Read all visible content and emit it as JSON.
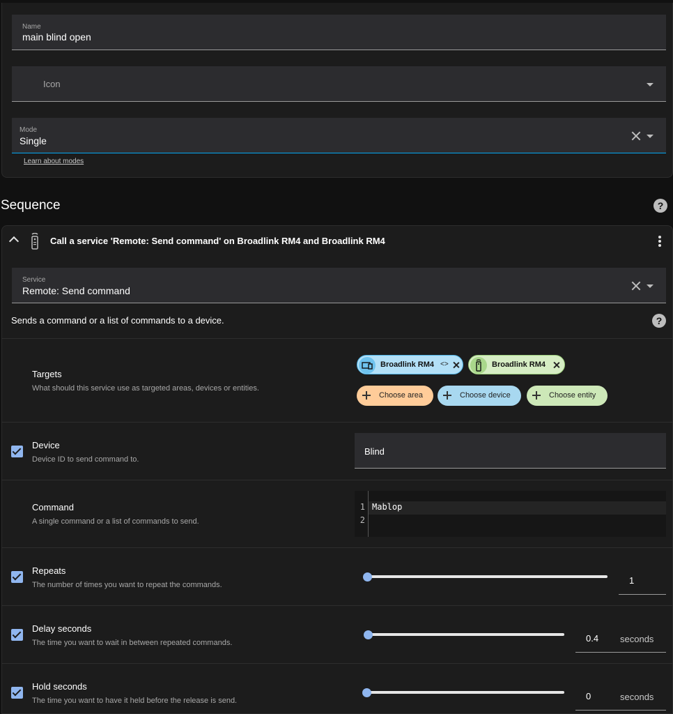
{
  "top_card": {
    "name_field": {
      "label": "Name",
      "value": "main blind open"
    },
    "icon_field": {
      "placeholder": "Icon"
    },
    "mode_field": {
      "label": "Mode",
      "value": "Single"
    },
    "learn_link": "Learn about modes"
  },
  "sequence": {
    "title": "Sequence",
    "help": "?",
    "action": {
      "heading": "Call a service 'Remote: Send command' on Broadlink RM4 and Broadlink RM4",
      "icon": "remote-icon",
      "service_field": {
        "label": "Service",
        "value": "Remote: Send command"
      },
      "description": "Sends a command or a list of commands to a device.",
      "desc_help": "?",
      "targets": {
        "title": "Targets",
        "subtitle": "What should this service use as targeted areas, devices or entities.",
        "chips": [
          {
            "label": "Broadlink RM4",
            "kind": "device",
            "icon": "devices-icon",
            "expand": "<>"
          },
          {
            "label": "Broadlink RM4",
            "kind": "entity",
            "icon": "remote-icon"
          }
        ],
        "add_buttons": [
          {
            "label": "Choose area",
            "color": "#ffcc99"
          },
          {
            "label": "Choose device",
            "color": "#a8d8f0"
          },
          {
            "label": "Choose entity",
            "color": "#cde8b8"
          }
        ]
      },
      "device": {
        "title": "Device",
        "subtitle": "Device ID to send command to.",
        "value": "Blind"
      },
      "command": {
        "title": "Command",
        "subtitle": "A single command or a list of commands to send.",
        "lines": [
          "1",
          "2"
        ],
        "code": "Mablop"
      },
      "repeats": {
        "title": "Repeats",
        "subtitle": "The number of times you want to repeat the commands.",
        "value": "1",
        "fraction": 0.0
      },
      "delay": {
        "title": "Delay seconds",
        "subtitle": "The time you want to wait in between repeated commands.",
        "value": "0.4",
        "unit": "seconds",
        "fraction": 0.0
      },
      "hold": {
        "title": "Hold seconds",
        "subtitle": "The time you want to have it held before the release is send.",
        "value": "0",
        "unit": "seconds",
        "fraction": 0.0
      }
    }
  },
  "colors": {
    "accent": "#03a9f4",
    "checkbox": "#90b6ef",
    "background": "#111111",
    "card": "#1c1c1c"
  }
}
